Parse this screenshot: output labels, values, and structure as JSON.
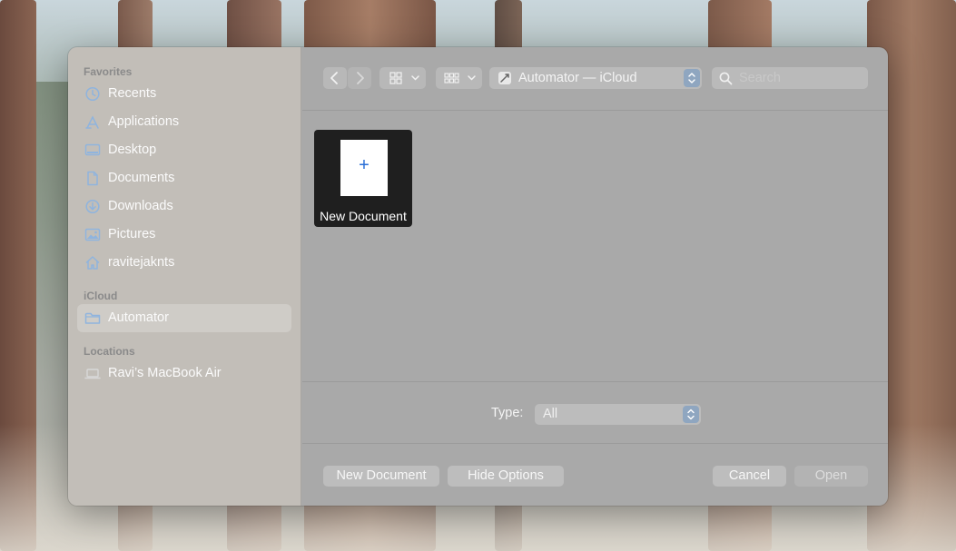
{
  "sidebar": {
    "sections": [
      {
        "label": "Favorites",
        "items": [
          {
            "label": "Recents",
            "icon": "clock-icon"
          },
          {
            "label": "Applications",
            "icon": "applications-icon"
          },
          {
            "label": "Desktop",
            "icon": "desktop-icon"
          },
          {
            "label": "Documents",
            "icon": "document-icon"
          },
          {
            "label": "Downloads",
            "icon": "download-icon"
          },
          {
            "label": "Pictures",
            "icon": "photo-icon"
          },
          {
            "label": "ravitejaknts",
            "icon": "home-icon"
          }
        ]
      },
      {
        "label": "iCloud",
        "items": [
          {
            "label": "Automator",
            "icon": "folder-icon",
            "selected": true
          }
        ]
      },
      {
        "label": "Locations",
        "items": [
          {
            "label": "Ravi’s MacBook Air",
            "icon": "laptop-icon"
          }
        ]
      }
    ]
  },
  "toolbar": {
    "location": "Automator — iCloud",
    "search_placeholder": "Search"
  },
  "content": {
    "item_label": "New Document",
    "item_glyph": "+"
  },
  "options": {
    "type_label": "Type:",
    "type_value": "All"
  },
  "footer": {
    "new_document": "New Document",
    "hide_options": "Hide Options",
    "cancel": "Cancel",
    "open": "Open"
  },
  "colors": {
    "accent_icon": "#8fb4de",
    "selection_plus": "#2a6ed6"
  }
}
